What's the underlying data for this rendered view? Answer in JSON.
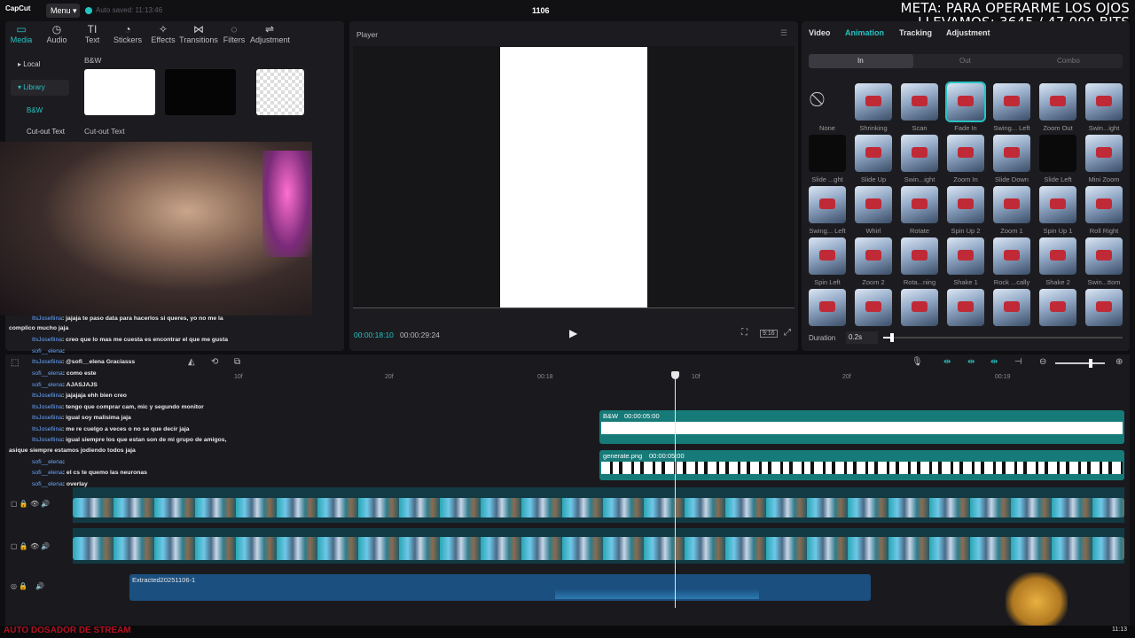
{
  "app": {
    "logo": "CapCut",
    "menu_label": "Menu",
    "autosave": "Auto saved: 11:13:46",
    "project_name": "1106"
  },
  "overlay": {
    "meta_line1": "META: PARA OPERARME LOS OJOS",
    "meta_line2": "LLEVAMOS: 3645 / 47.000 BITS",
    "bottom_left": "AUTO DOSADOR DE STREAM",
    "clock": "11:13"
  },
  "media_panel": {
    "tools": [
      {
        "label": "Media",
        "icon": "media-icon",
        "glyph": "▭"
      },
      {
        "label": "Audio",
        "icon": "audio-icon",
        "glyph": "◷"
      },
      {
        "label": "Text",
        "icon": "text-icon",
        "glyph": "TI"
      },
      {
        "label": "Stickers",
        "icon": "stickers-icon",
        "glyph": "◔"
      },
      {
        "label": "Effects",
        "icon": "effects-icon",
        "glyph": "✧"
      },
      {
        "label": "Transitions",
        "icon": "transitions-icon",
        "glyph": "⋈"
      },
      {
        "label": "Filters",
        "icon": "filters-icon",
        "glyph": "◌"
      },
      {
        "label": "Adjustment",
        "icon": "adjustment-icon",
        "glyph": "⇌"
      }
    ],
    "sidebar": [
      {
        "label": "▸ Local"
      },
      {
        "label": "▾ Library"
      },
      {
        "label": "B&W"
      },
      {
        "label": "Cut-out Text"
      }
    ],
    "section_label": "B&W",
    "section_label2": "Cut-out Text"
  },
  "player": {
    "title": "Player",
    "current_time": "00:00:18:10",
    "total_time": "00:00:29:24",
    "ratio_label": "9:16"
  },
  "right_panel": {
    "tabs": [
      "Video",
      "Animation",
      "Tracking",
      "Adjustment"
    ],
    "segments": [
      "In",
      "Out",
      "Combo"
    ],
    "animations": [
      "None",
      "Shrinking",
      "Scan",
      "Fade In",
      "Swing... Left",
      "Zoom Out",
      "Swin...ight",
      "Slide ...ght",
      "Slide Up",
      "Swin...ight",
      "Zoom In",
      "Slide Down",
      "Slide Left",
      "Mini Zoom",
      "Swing... Left",
      "Whirl",
      "Rotate",
      "Spin Up 2",
      "Zoom 1",
      "Spin Up 1",
      "Roll Right",
      "Spin Left",
      "Zoom 2",
      "Rota...ning",
      "Shake 1",
      "Rock ...cally",
      "Shake 2",
      "Swin...ttom",
      "",
      "",
      "",
      "",
      "",
      "",
      ""
    ],
    "duration_label": "Duration",
    "duration_value": "0.2s"
  },
  "timeline": {
    "ruler": [
      "10f",
      "20f",
      "00:18",
      "10f",
      "20f",
      "00:19"
    ],
    "text_clip": {
      "name": "B&W",
      "duration": "00:00:05:00"
    },
    "sticker_clip": {
      "name": "generate.png",
      "duration": "00:00:05:00"
    },
    "audio_clip": {
      "name": "Extracted20251106-1"
    }
  },
  "chat": [
    {
      "user": "ItsJosefiina",
      "msg": ": jajaja te paso data para hacerlos si queres, yo no me la"
    },
    {
      "user": "",
      "msg": "complico mucho jaja"
    },
    {
      "user": "ItsJosefiina",
      "msg": ": creo que lo mas me cuesta es encontrar el que me gusta"
    },
    {
      "user": "sofi__elena",
      "msg": ":"
    },
    {
      "user": "ItsJosefiina",
      "msg": ": @sofi__elena Graciasss"
    },
    {
      "user": "sofi__elena",
      "msg": ": como este"
    },
    {
      "user": "sofi__elena",
      "msg": ": AJASJAJS"
    },
    {
      "user": "ItsJosefiina",
      "msg": ": jajajaja ehh bien creo"
    },
    {
      "user": "ItsJosefiina",
      "msg": ": tengo que comprar cam, mic y segundo monitor"
    },
    {
      "user": "ItsJosefiina",
      "msg": ": igual soy malisima jaja"
    },
    {
      "user": "ItsJosefiina",
      "msg": ": me re cuelgo a veces o no se que decir jaja"
    },
    {
      "user": "ItsJosefiina",
      "msg": ": igual siempre los que estan son de mi grupo de amigos,"
    },
    {
      "user": "",
      "msg": "asique siempre estamos jodiendo todos jaja"
    },
    {
      "user": "sofi__elena",
      "msg": ":"
    },
    {
      "user": "sofi__elena",
      "msg": ": el cs te quemo las neuronas"
    },
    {
      "user": "sofi__elena",
      "msg": ": overlay"
    }
  ],
  "colors": {
    "accent": "#27c3c3",
    "panel": "#1c1c20",
    "teal_clip": "#167a78"
  }
}
